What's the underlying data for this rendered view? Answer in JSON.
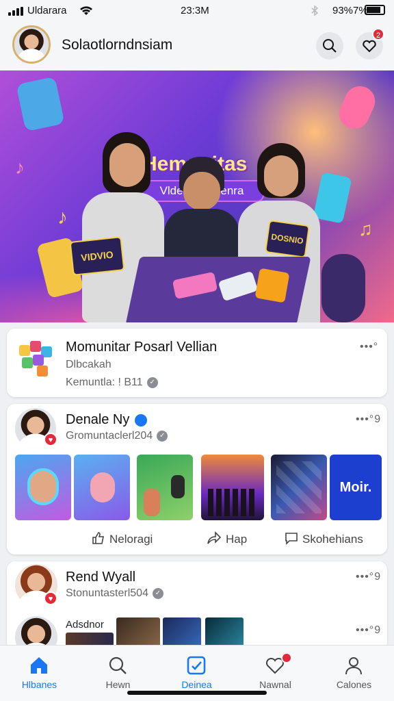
{
  "status": {
    "carrier": "Uldarara",
    "time": "23:3M",
    "battery": "93%7%"
  },
  "header": {
    "username": "Solaotlorndnsiam",
    "notif_count": "2"
  },
  "hero": {
    "title": "Hemunitas",
    "subtitle": "Vlderuniaitsenra",
    "sticker_left": "VIDVIO",
    "sticker_right": "DOSNIO"
  },
  "cards": [
    {
      "title": "Momunitar Posarl Vellian",
      "line1": "Dlbcakah",
      "line2": "Kemuntla: ! B11",
      "more": "•••°"
    },
    {
      "name": "Denale Ny",
      "sub": "Gromuntaclerl204",
      "more": "•••°9",
      "thumb_text": "Moir.",
      "actions": [
        "Neloragi",
        "Hap",
        "Skohehians"
      ]
    },
    {
      "name": "Rend Wyall",
      "sub": "Stonuntasterl504",
      "more": "•••°9",
      "more2": "•••°9",
      "caption": "Adsdnor"
    }
  ],
  "nav": [
    "Hlbanes",
    "Hewn",
    "Deinea",
    "Nawnal",
    "Calones"
  ],
  "colors": {
    "accent": "#1877f2",
    "badge": "#e5283a",
    "nav_active": "#1877f2"
  }
}
